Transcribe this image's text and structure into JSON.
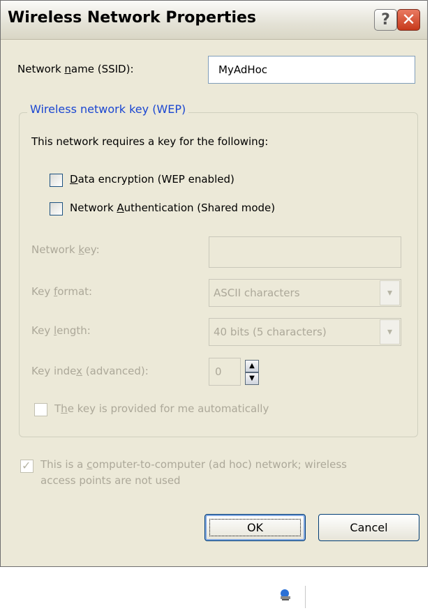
{
  "window": {
    "title": "Wireless Network Properties",
    "help_glyph": "?",
    "close_glyph": "✕"
  },
  "ssid": {
    "label": "Network name (SSID):",
    "value": "MyAdHoc"
  },
  "wep_group": {
    "legend": "Wireless network key (WEP)",
    "intro": "This network requires a key for the following:",
    "data_encryption": {
      "label": "Data encryption (WEP enabled)",
      "checked": false
    },
    "network_auth": {
      "label": "Network Authentication (Shared mode)",
      "checked": false
    },
    "network_key": {
      "label": "Network key:",
      "value": ""
    },
    "key_format": {
      "label": "Key format:",
      "value": "ASCII characters"
    },
    "key_length": {
      "label": "Key length:",
      "value": "40 bits (5 characters)"
    },
    "key_index": {
      "label": "Key index (advanced):",
      "value": "0"
    },
    "auto_key": {
      "label": "The key is provided for me automatically",
      "checked": false
    }
  },
  "adhoc": {
    "line1": "This is a computer-to-computer (ad hoc) network; wireless",
    "line2": "access points are not used",
    "checked": true
  },
  "buttons": {
    "ok": "OK",
    "cancel": "Cancel"
  },
  "icons": {
    "dropdown": "chevron-down-icon",
    "spin_up": "arrow-up-icon",
    "spin_down": "arrow-down-icon",
    "tray": "network-tray-icon"
  },
  "colors": {
    "dialog_bg": "#ece9d8",
    "group_legend": "#1a46d1",
    "close_button": "#c7391b",
    "disabled_text": "#aca899"
  }
}
